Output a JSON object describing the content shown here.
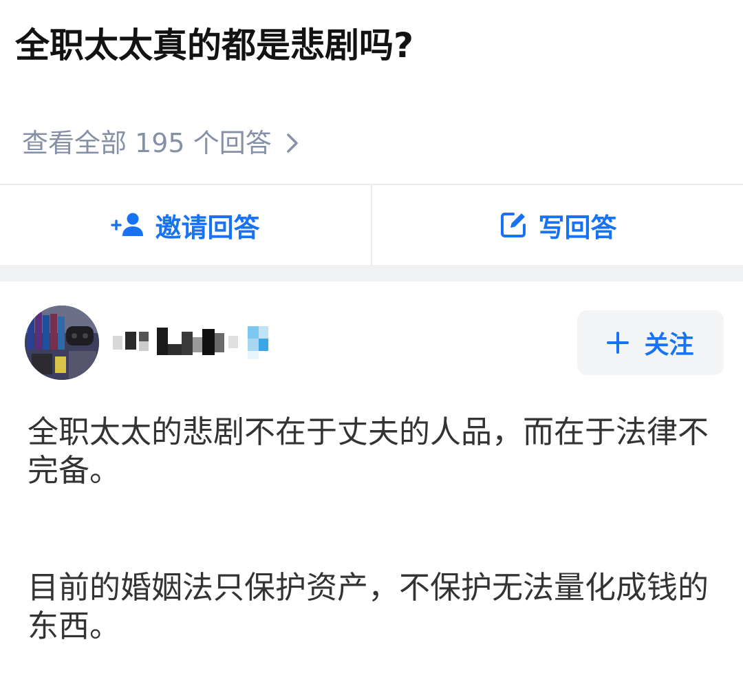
{
  "question": {
    "title": "全职太太真的都是悲剧吗?"
  },
  "answers_link": {
    "label": "查看全部 195 个回答"
  },
  "actions": {
    "invite_label": "邀请回答",
    "write_label": "写回答"
  },
  "author": {
    "follow_label": "关注"
  },
  "answer": {
    "paragraphs": [
      "全职太太的悲剧不在于丈夫的人品，而在于法律不完备。",
      "目前的婚姻法只保护资产，不保护无法量化成钱的东西。"
    ]
  },
  "colors": {
    "accent": "#1772f6",
    "muted": "#8590a6",
    "band": "#f0f1f3"
  },
  "icons": {
    "invite": "add-user-icon",
    "write": "edit-icon",
    "follow": "plus-icon",
    "more": "chevron-right-icon"
  }
}
